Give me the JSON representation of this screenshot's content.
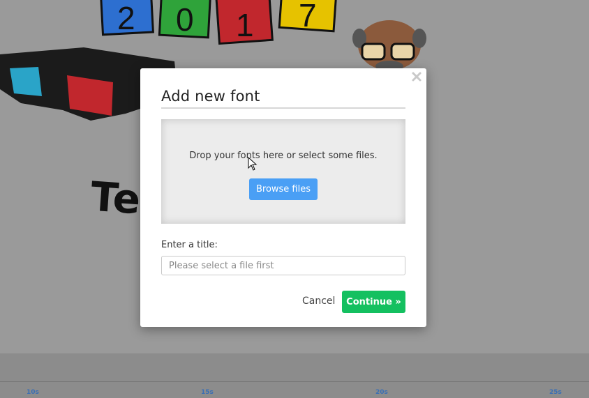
{
  "background": {
    "year_digits": [
      "2",
      "0",
      "1",
      "7"
    ],
    "partial_text": "Te"
  },
  "timeline": {
    "ticks": [
      "10s",
      "15s",
      "20s",
      "25s"
    ]
  },
  "modal": {
    "title": "Add new font",
    "dropzone_hint": "Drop your fonts here or select some files.",
    "browse_label": "Browse files",
    "title_label": "Enter a title:",
    "title_placeholder": "Please select a file first",
    "cancel_label": "Cancel",
    "continue_label": "Continue »",
    "close_icon": "close-icon"
  },
  "colors": {
    "primary_blue": "#4a9ff5",
    "continue_green": "#14c060"
  }
}
